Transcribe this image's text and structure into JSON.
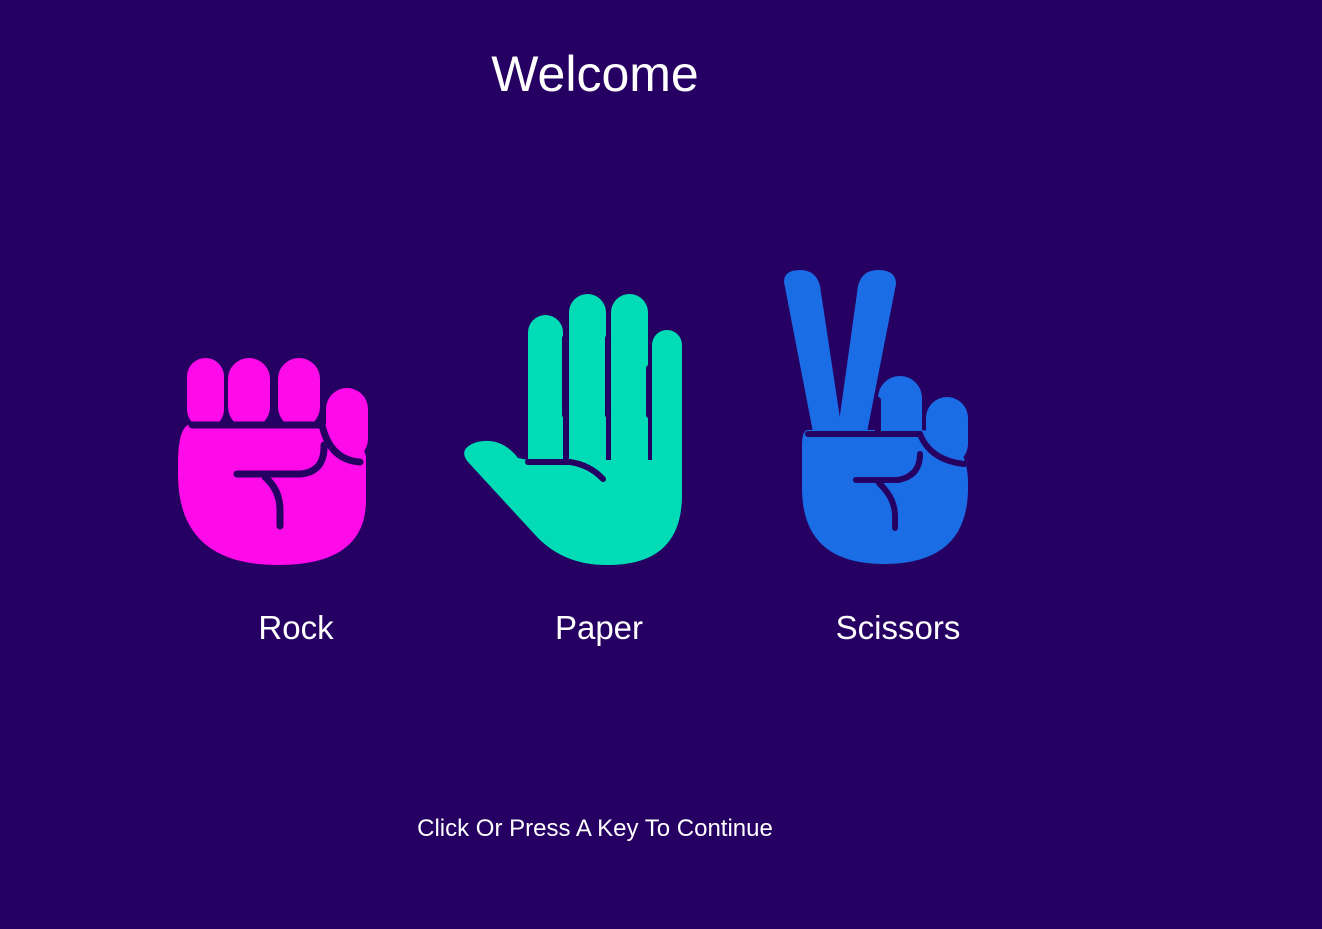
{
  "colors": {
    "background": "#250062",
    "text": "#ffffff",
    "rock": "#ff0be9",
    "paper": "#02dcb6",
    "scissors": "#1b6de5",
    "hand_lines": "#250062"
  },
  "header": {
    "title": "Welcome"
  },
  "choices": [
    {
      "label": "Rock",
      "icon": "fist-icon"
    },
    {
      "label": "Paper",
      "icon": "open-hand-icon"
    },
    {
      "label": "Scissors",
      "icon": "peace-hand-icon"
    }
  ],
  "footer": {
    "prompt": "Click Or Press A Key To Continue"
  }
}
